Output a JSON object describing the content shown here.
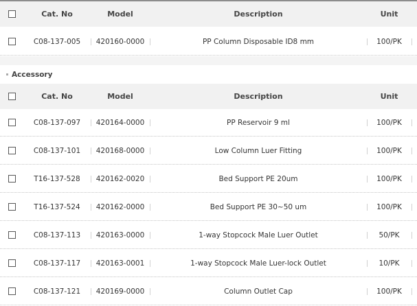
{
  "columns": {
    "cat_no": "Cat. No",
    "model": "Model",
    "description": "Description",
    "unit": "Unit"
  },
  "main_table": {
    "rows": [
      {
        "cat_no": "C08-137-005",
        "model": "420160-0000",
        "description": "PP Column Disposable ID8 mm",
        "unit": "100/PK"
      }
    ]
  },
  "accessory": {
    "title": "Accessory",
    "rows": [
      {
        "cat_no": "C08-137-097",
        "model": "420164-0000",
        "description": "PP Reservoir 9 ml",
        "unit": "100/PK"
      },
      {
        "cat_no": "C08-137-101",
        "model": "420168-0000",
        "description": "Low Column Luer Fitting",
        "unit": "100/PK"
      },
      {
        "cat_no": "T16-137-528",
        "model": "420162-0020",
        "description": "Bed Support PE 20um",
        "unit": "100/PK"
      },
      {
        "cat_no": "T16-137-524",
        "model": "420162-0000",
        "description": "Bed Support PE 30~50 um",
        "unit": "100/PK"
      },
      {
        "cat_no": "C08-137-113",
        "model": "420163-0000",
        "description": "1-way Stopcock Male Luer Outlet",
        "unit": "50/PK"
      },
      {
        "cat_no": "C08-137-117",
        "model": "420163-0001",
        "description": "1-way Stopcock Male Luer-lock Outlet",
        "unit": "10/PK"
      },
      {
        "cat_no": "C08-137-121",
        "model": "420169-0000",
        "description": "Column Outlet Cap",
        "unit": "100/PK"
      }
    ]
  }
}
